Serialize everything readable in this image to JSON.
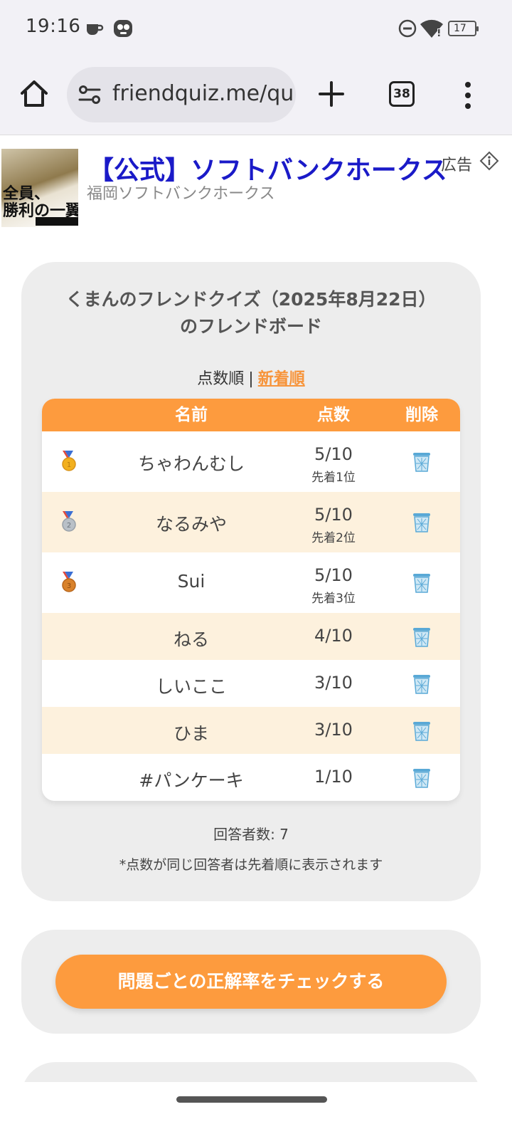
{
  "status": {
    "time": "19:16",
    "battery": "17",
    "icons": [
      "coffee-cup-icon",
      "face-icon",
      "do-not-disturb-icon",
      "wifi-icon",
      "battery-icon"
    ]
  },
  "browser": {
    "url": "friendquiz.me/qui",
    "tab_count": "38",
    "icons": [
      "home-icon",
      "site-settings-icon",
      "plus-icon",
      "more-vert-icon"
    ]
  },
  "ad": {
    "title": "【公式】ソフトバンクホークス",
    "subtitle": "福岡ソフトバンクホークス",
    "label": "広告",
    "image_text": "全員、\n勝利の一翼。"
  },
  "board": {
    "title_line1": "くまんのフレンドクイズ（2025年8月22日）",
    "title_line2": "のフレンドボード",
    "sort": {
      "score_order": "点数順",
      "separator": "|",
      "newest_order": "新着順"
    },
    "headers": {
      "name": "名前",
      "score": "点数",
      "delete": "削除"
    },
    "rows": [
      {
        "medal": "gold",
        "name": "ちゃわんむし",
        "score": "5/10",
        "rank": "先着1位"
      },
      {
        "medal": "silver",
        "name": "なるみや",
        "score": "5/10",
        "rank": "先着2位"
      },
      {
        "medal": "bronze",
        "name": "Sui",
        "score": "5/10",
        "rank": "先着3位"
      },
      {
        "medal": "",
        "name": "ねる",
        "score": "4/10",
        "rank": ""
      },
      {
        "medal": "",
        "name": "しいここ",
        "score": "3/10",
        "rank": ""
      },
      {
        "medal": "",
        "name": "ひま",
        "score": "3/10",
        "rank": ""
      },
      {
        "medal": "",
        "name": "#パンケーキ",
        "score": "1/10",
        "rank": ""
      }
    ],
    "respondents": "回答者数: 7",
    "note": "*点数が同じ回答者は先着順に表示されます"
  },
  "check_button": "問題ごとの正解率をチェックする",
  "colors": {
    "accent": "#fd9b3e",
    "row_alt": "#fdf1dd",
    "card_bg": "#ededed",
    "ad_title": "#1a1ac8",
    "gold": "#f2b01e",
    "silver": "#b9c0c7",
    "bronze": "#d9822b",
    "ribbon": "#3b6fd4",
    "trash": "#5aa9d6"
  }
}
